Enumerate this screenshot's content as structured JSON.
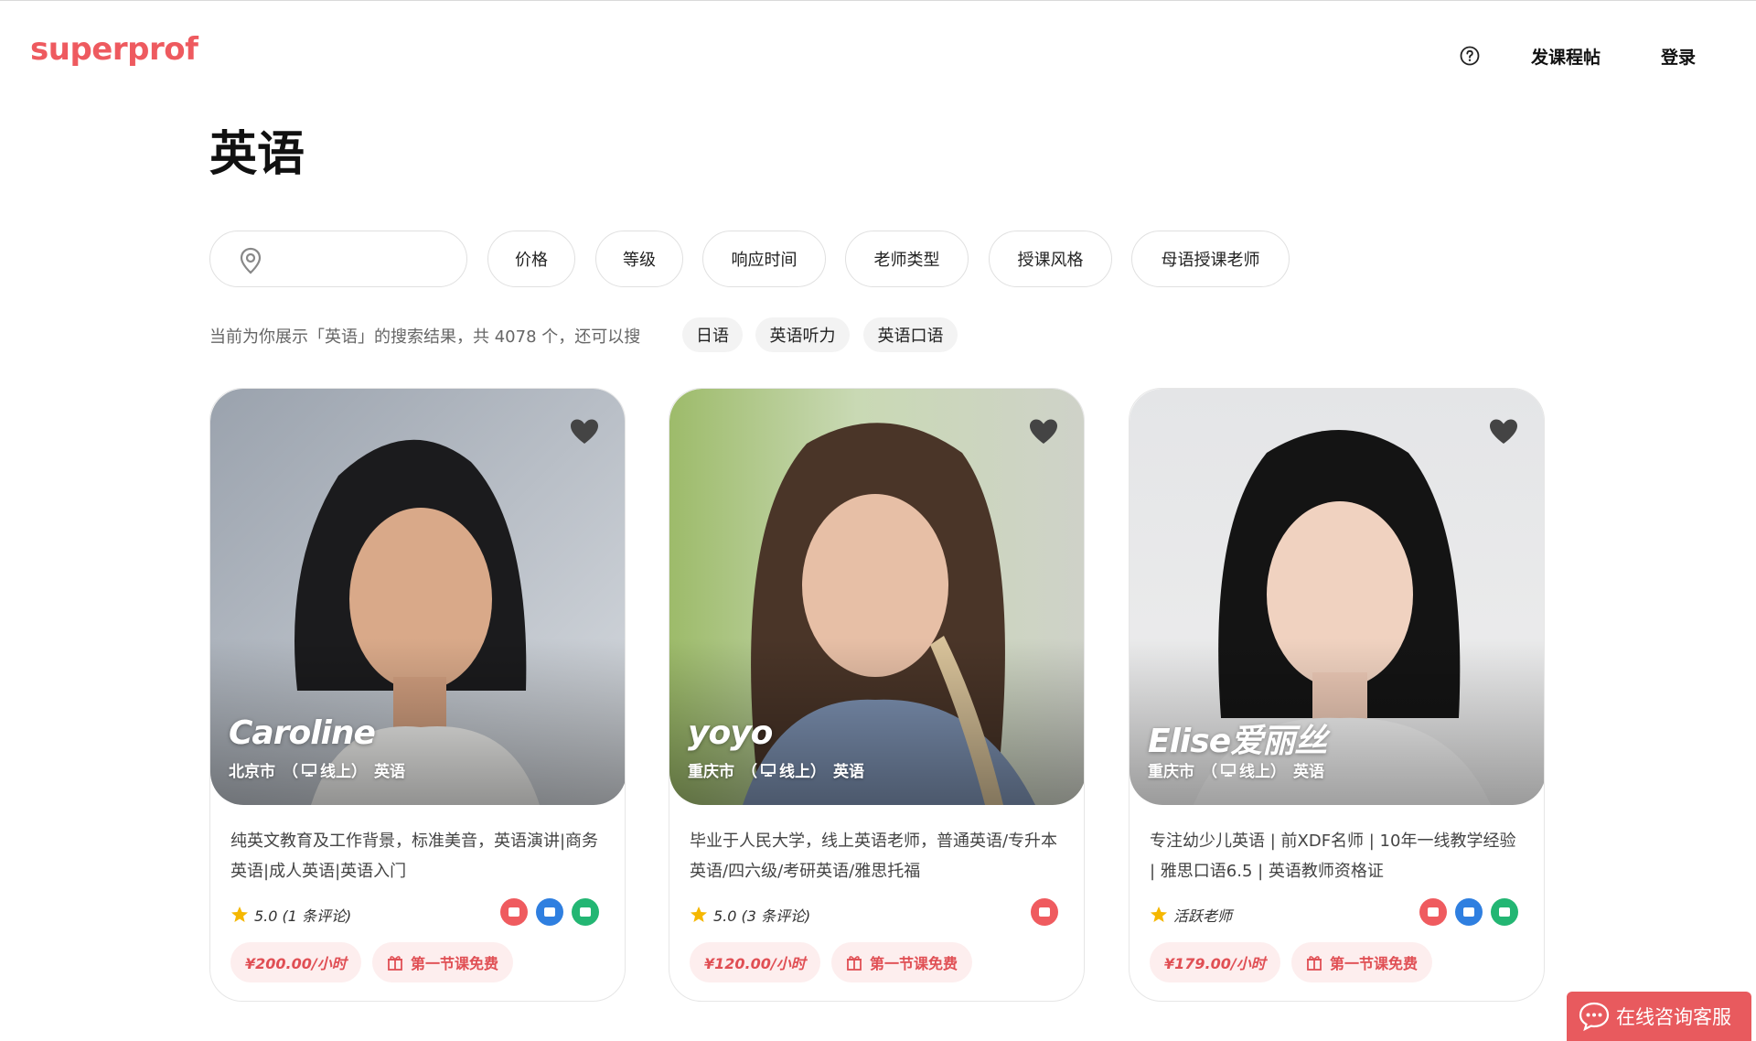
{
  "header": {
    "logo": "superprof",
    "help_icon": "help-circle-icon",
    "post_course": "发课程帖",
    "login": "登录"
  },
  "page_title": "英语",
  "filters": {
    "location_placeholder": "",
    "location_icon": "location-pin-icon",
    "chips": [
      "价格",
      "等级",
      "响应时间",
      "老师类型",
      "授课风格",
      "母语授课老师"
    ]
  },
  "results": {
    "summary": "当前为你展示「英语」的搜索结果，共 4078 个，还可以搜",
    "suggestions": [
      "日语",
      "英语听力",
      "英语口语"
    ]
  },
  "cards": [
    {
      "name": "Caroline",
      "city": "北京市",
      "mode": "（",
      "mode_label": "线上）",
      "subject": "英语",
      "description": "纯英文教育及工作背景，标准美音，英语演讲|商务英语|成人英语|英语入门",
      "rating": "5.0 (1 条评论)",
      "price": "¥200.00/小时",
      "free_lesson": "第一节课免费",
      "badges": [
        "#ef5b5f",
        "#2f7fe0",
        "#23b673"
      ]
    },
    {
      "name": "yoyo",
      "city": "重庆市",
      "mode": "（",
      "mode_label": "线上）",
      "subject": "英语",
      "description": "毕业于人民大学，线上英语老师，普通英语/专升本英语/四六级/考研英语/雅思托福",
      "rating": "5.0 (3 条评论)",
      "price": "¥120.00/小时",
      "free_lesson": "第一节课免费",
      "badges": [
        "#ef5b5f"
      ]
    },
    {
      "name": "Elise爱丽丝",
      "city": "重庆市",
      "mode": "（",
      "mode_label": "线上）",
      "subject": "英语",
      "description": "专注幼少儿英语 | 前XDF名师 | 10年一线教学经验 | 雅思口语6.5 | 英语教师资格证",
      "rating": "活跃老师",
      "price": "¥179.00/小时",
      "free_lesson": "第一节课免费",
      "badges": [
        "#ef5b5f",
        "#2f7fe0",
        "#23b673"
      ]
    }
  ],
  "chat": {
    "label": "在线咨询客服",
    "icon": "chat-bubble-icon"
  },
  "colors": {
    "brand": "#ee5a5f",
    "price_bg": "#fdeeee",
    "price_text": "#e04f54",
    "star": "#f5b700"
  }
}
